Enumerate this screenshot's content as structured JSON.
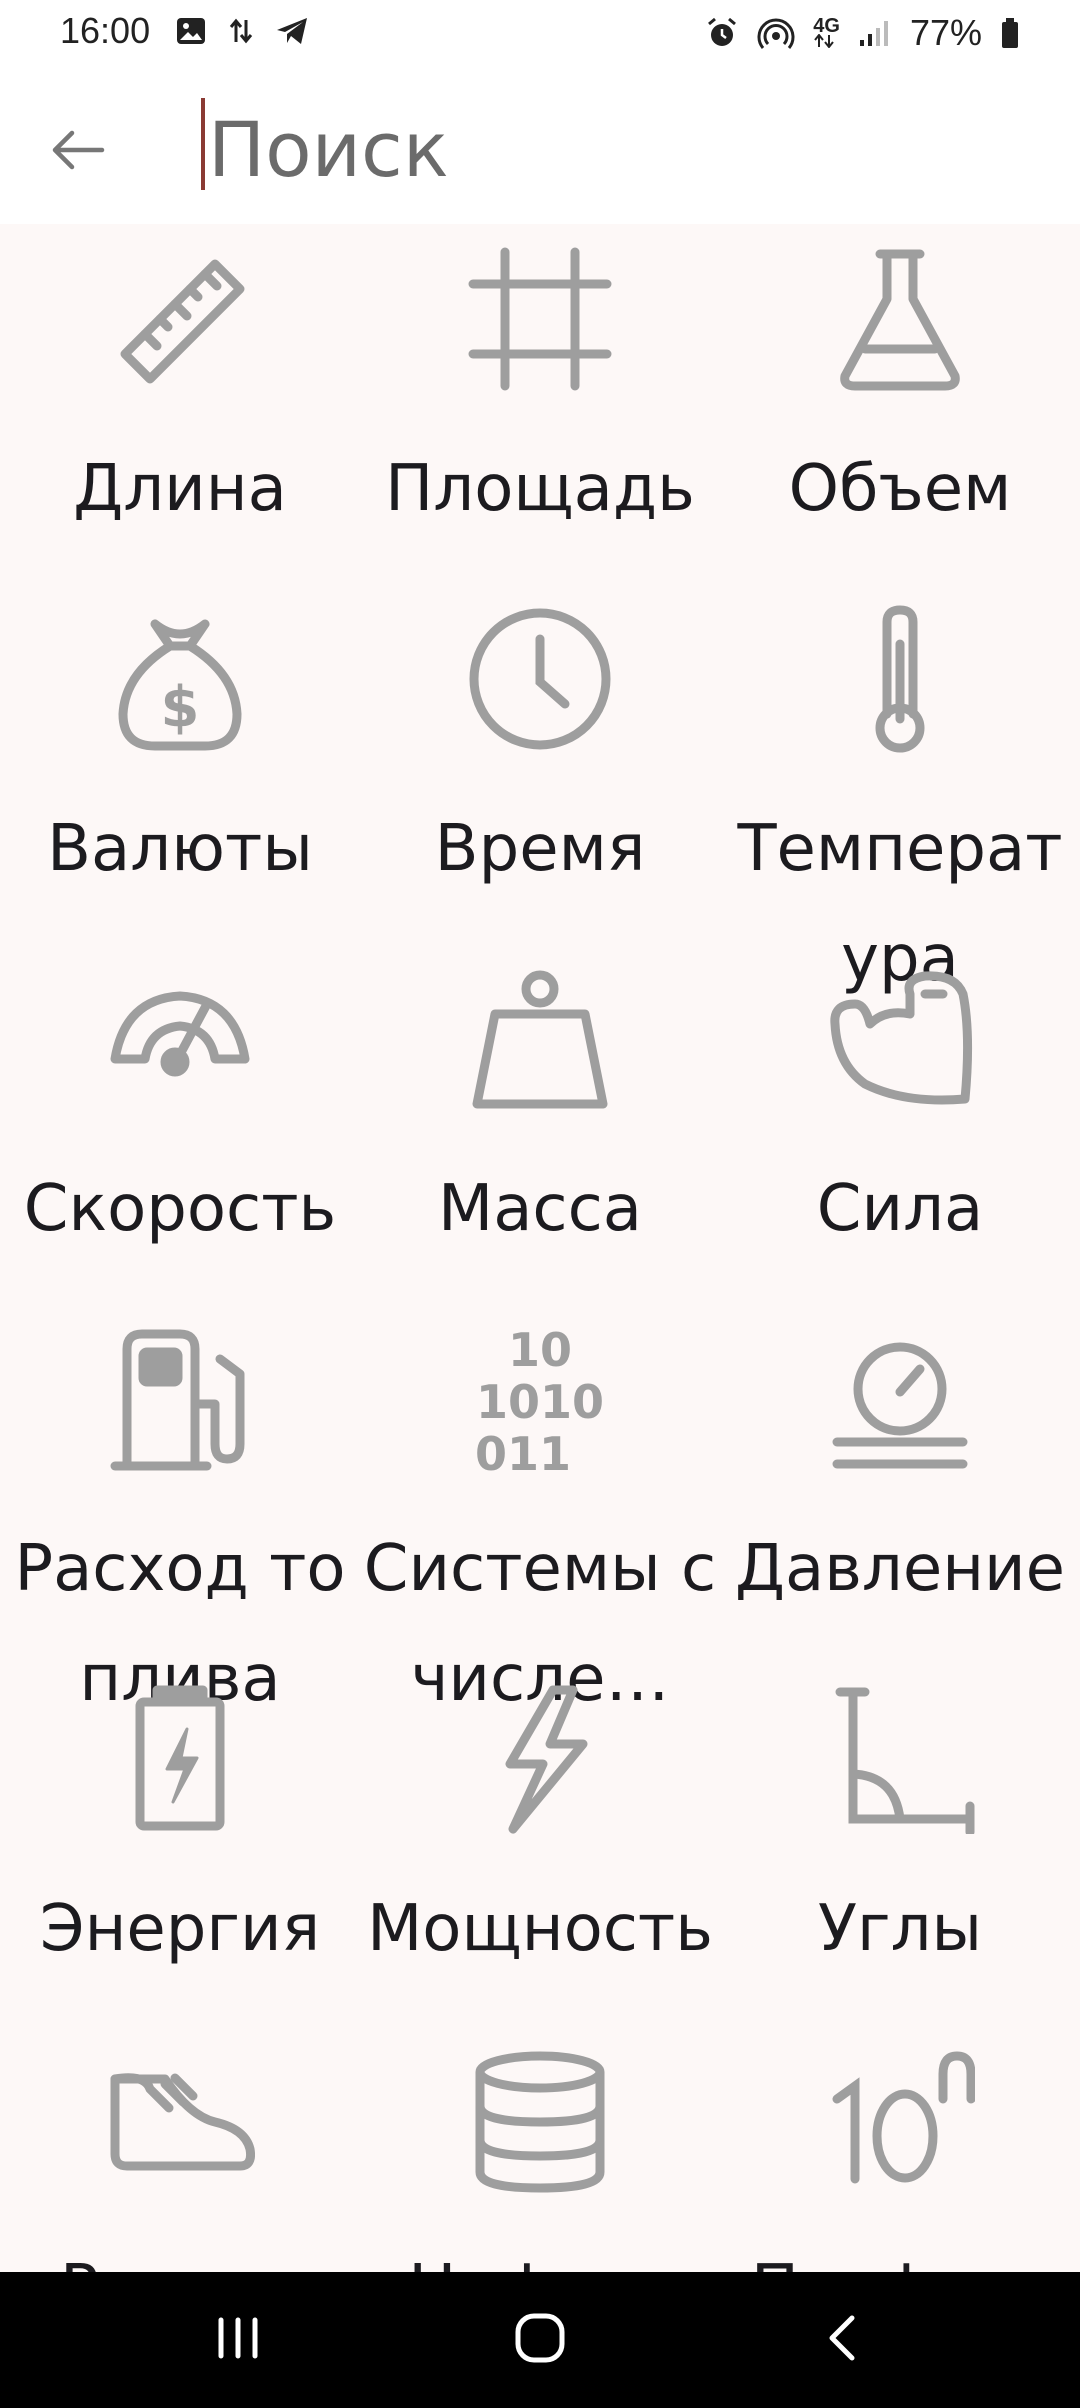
{
  "status_bar": {
    "time": "16:00",
    "left_icons": [
      "image-icon",
      "data-transfer-icon",
      "telegram-icon"
    ],
    "right_icons": [
      "alarm-icon",
      "hotspot-icon",
      "4g-icon",
      "signal-icon"
    ],
    "network": "4G",
    "battery": "77%"
  },
  "search": {
    "placeholder": "Поиск",
    "value": ""
  },
  "categories": [
    {
      "label": "Длина",
      "icon": "ruler-icon"
    },
    {
      "label": "Площадь",
      "icon": "area-icon"
    },
    {
      "label": "Объем",
      "icon": "flask-icon"
    },
    {
      "label": "Валюты",
      "icon": "money-bag-icon"
    },
    {
      "label": "Время",
      "icon": "clock-icon"
    },
    {
      "label": "Температура",
      "icon": "thermometer-icon"
    },
    {
      "label": "Скорость",
      "icon": "speedometer-icon"
    },
    {
      "label": "Масса",
      "icon": "weight-icon"
    },
    {
      "label": "Сила",
      "icon": "muscle-icon"
    },
    {
      "label": "Расход топлива",
      "icon": "fuel-pump-icon"
    },
    {
      "label": "Системы счисле…",
      "icon": "binary-icon"
    },
    {
      "label": "Давление",
      "icon": "pressure-gauge-icon"
    },
    {
      "label": "Энергия",
      "icon": "battery-icon"
    },
    {
      "label": "Мощность",
      "icon": "lightning-icon"
    },
    {
      "label": "Углы",
      "icon": "angle-icon"
    },
    {
      "label": "Размер",
      "icon": "shoe-icon"
    },
    {
      "label": "Цифров",
      "icon": "database-icon"
    },
    {
      "label": "Префикс",
      "icon": "exponent-icon"
    }
  ],
  "colors": {
    "icon": "#9e9e9e",
    "background": "#fdf8f7",
    "caret": "#8a3a33"
  }
}
